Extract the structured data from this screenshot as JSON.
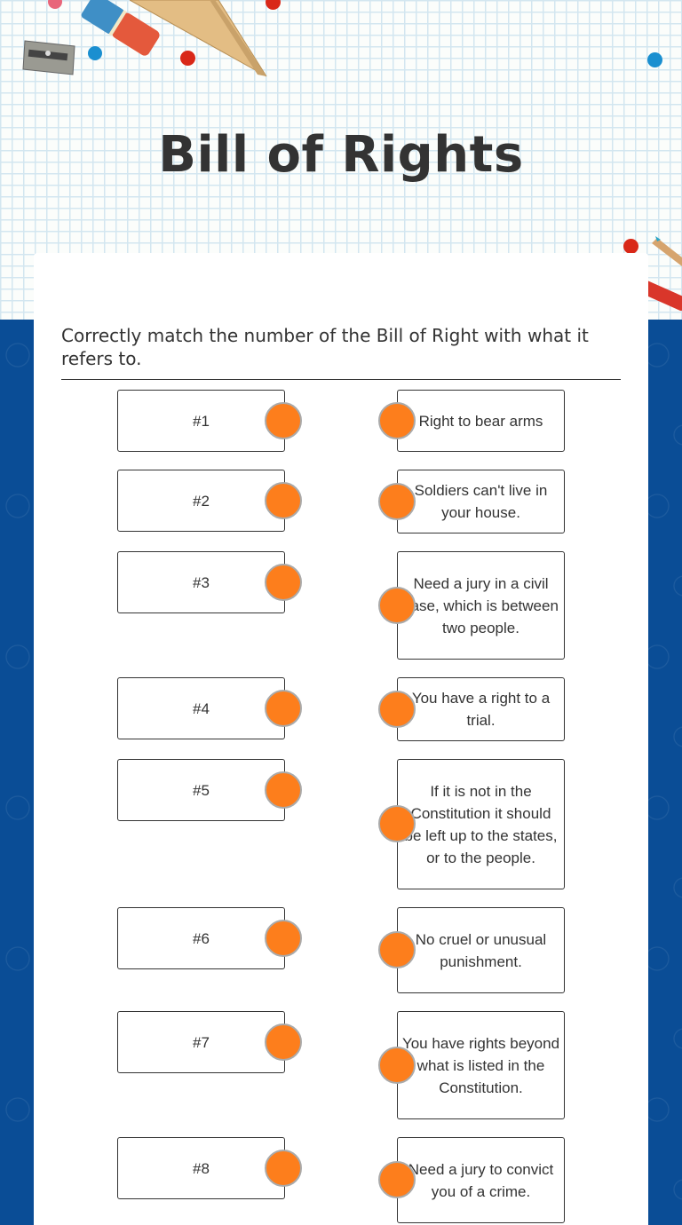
{
  "page": {
    "title": "Bill of Rights",
    "instructions": "Correctly match the number of the Bill of Right with what it refers to."
  },
  "colors": {
    "accent_handle": "#fd7e1c",
    "band_blue": "#0a4d96",
    "text": "#333333"
  },
  "decorations": [
    "pencil-sharpener-icon",
    "eraser-icon",
    "ruler-triangle-icon",
    "pencil-icon"
  ],
  "left_items": [
    {
      "label": "#1"
    },
    {
      "label": "#2"
    },
    {
      "label": "#3"
    },
    {
      "label": "#4"
    },
    {
      "label": "#5"
    },
    {
      "label": "#6"
    },
    {
      "label": "#7"
    },
    {
      "label": "#8"
    }
  ],
  "right_items": [
    {
      "label": "Right to bear arms"
    },
    {
      "label": "Soldiers can't live in your house."
    },
    {
      "label": "Need a jury in a civil case, which is between two people."
    },
    {
      "label": "You have a right to a trial."
    },
    {
      "label": "If it is not in the Constitution it should be left up to the states, or to the people."
    },
    {
      "label": "No cruel or unusual punishment."
    },
    {
      "label": "You have rights beyond what is listed in the Constitution."
    },
    {
      "label": "Need a jury to convict you of a crime."
    }
  ]
}
